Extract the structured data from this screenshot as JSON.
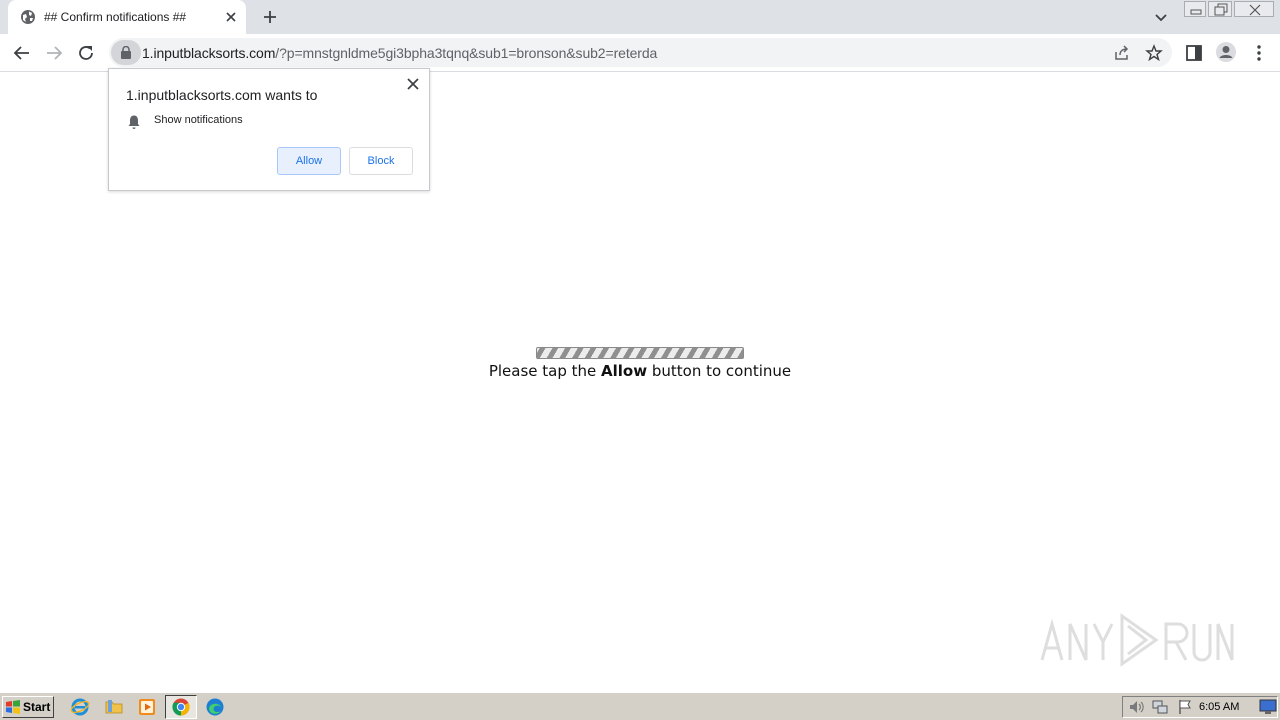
{
  "browser": {
    "tab": {
      "title": "## Confirm notifications ##",
      "favicon": "globe-icon"
    },
    "address_bar": {
      "domain": "1.inputblacksorts.com",
      "path": "/?p=mnstgnldme5gi3bpha3tqnq&sub1=bronson&sub2=reterda"
    }
  },
  "permission_prompt": {
    "title": "1.inputblacksorts.com wants to",
    "permission": "Show notifications",
    "allow_label": "Allow",
    "block_label": "Block"
  },
  "page": {
    "progress": 1.0,
    "instruction_prefix": "Please tap the ",
    "instruction_bold": "Allow",
    "instruction_suffix": " button to continue"
  },
  "taskbar": {
    "start_label": "Start",
    "clock": "6:05 AM"
  },
  "colors": {
    "accent": "#1a73e8",
    "tabstrip": "#dee1e6",
    "taskbar": "#d4d0c8"
  }
}
